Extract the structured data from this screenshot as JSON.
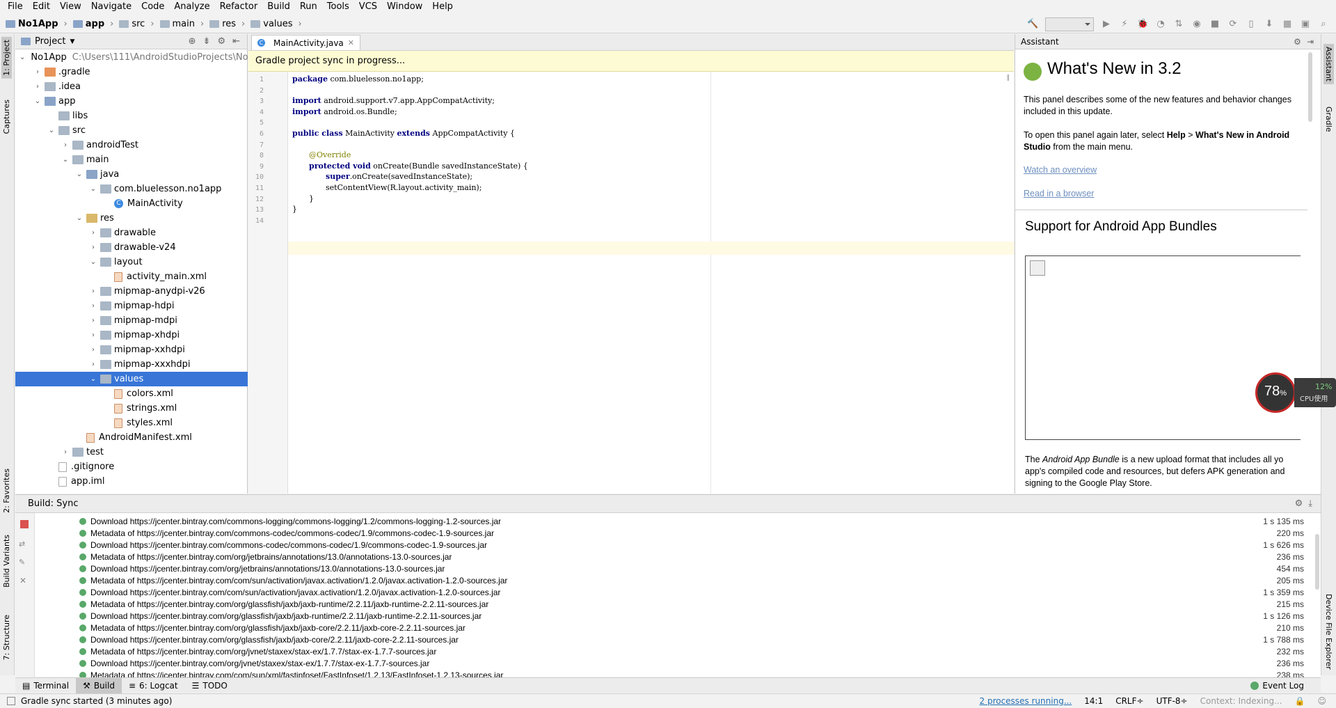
{
  "menu": [
    "File",
    "Edit",
    "View",
    "Navigate",
    "Code",
    "Analyze",
    "Refactor",
    "Build",
    "Run",
    "Tools",
    "VCS",
    "Window",
    "Help"
  ],
  "breadcrumb": [
    "No1App",
    "app",
    "src",
    "main",
    "res",
    "values"
  ],
  "left_tabs": {
    "project": "1: Project",
    "captures": "Captures",
    "favorites": "2: Favorites",
    "build_variants": "Build Variants",
    "structure": "7: Structure"
  },
  "right_tabs": {
    "assistant": "Assistant",
    "gradle": "Gradle",
    "device_file_explorer": "Device File Explorer"
  },
  "project_panel": {
    "title": "Project",
    "tree": [
      {
        "label": "No1App",
        "path": "C:\\Users\\111\\AndroidStudioProjects\\No",
        "icon": "folder-icon"
      },
      {
        "label": ".gradle",
        "icon": "folder-icon"
      },
      {
        "label": ".idea",
        "icon": "folder-icon"
      },
      {
        "label": "app",
        "icon": "folder-icon"
      },
      {
        "label": "libs",
        "icon": "folder-icon"
      },
      {
        "label": "src",
        "icon": "folder-icon"
      },
      {
        "label": "androidTest",
        "icon": "folder-icon"
      },
      {
        "label": "main",
        "icon": "folder-icon"
      },
      {
        "label": "java",
        "icon": "folder-icon"
      },
      {
        "label": "com.bluelesson.no1app",
        "icon": "package-icon"
      },
      {
        "label": "MainActivity",
        "icon": "class-icon"
      },
      {
        "label": "res",
        "icon": "folder-icon"
      },
      {
        "label": "drawable",
        "icon": "folder-icon"
      },
      {
        "label": "drawable-v24",
        "icon": "folder-icon"
      },
      {
        "label": "layout",
        "icon": "folder-icon"
      },
      {
        "label": "activity_main.xml",
        "icon": "xml-icon"
      },
      {
        "label": "mipmap-anydpi-v26",
        "icon": "folder-icon"
      },
      {
        "label": "mipmap-hdpi",
        "icon": "folder-icon"
      },
      {
        "label": "mipmap-mdpi",
        "icon": "folder-icon"
      },
      {
        "label": "mipmap-xhdpi",
        "icon": "folder-icon"
      },
      {
        "label": "mipmap-xxhdpi",
        "icon": "folder-icon"
      },
      {
        "label": "mipmap-xxxhdpi",
        "icon": "folder-icon"
      },
      {
        "label": "values",
        "icon": "folder-icon"
      },
      {
        "label": "colors.xml",
        "icon": "xml-icon"
      },
      {
        "label": "strings.xml",
        "icon": "xml-icon"
      },
      {
        "label": "styles.xml",
        "icon": "xml-icon"
      },
      {
        "label": "AndroidManifest.xml",
        "icon": "xml-icon"
      },
      {
        "label": "test",
        "icon": "folder-icon"
      },
      {
        "label": ".gitignore",
        "icon": "file-icon"
      },
      {
        "label": "app.iml",
        "icon": "file-icon"
      }
    ]
  },
  "editor": {
    "tab": "MainActivity.java",
    "banner": "Gradle project sync in progress...",
    "lines": [
      "1",
      "2",
      "3",
      "4",
      "5",
      "6",
      "7",
      "8",
      "9",
      "10",
      "11",
      "12",
      "13",
      "14"
    ],
    "code": {
      "l1_kw": "package",
      "l1": " com.bluelesson.no1app;",
      "l3_kw": "import",
      "l3": " android.support.v7.app.AppCompatActivity;",
      "l4_kw": "import",
      "l4": " android.os.Bundle;",
      "l6_kw1": "public class",
      "l6a": " MainActivity ",
      "l6_kw2": "extends",
      "l6b": " AppCompatActivity {",
      "l8": "@Override",
      "l9_kw": "protected void",
      "l9": " onCreate(Bundle savedInstanceState) {",
      "l10_kw": "super",
      "l10": ".onCreate(savedInstanceState);",
      "l11": "setContentView(R.layout.activity_main);",
      "l12": "}",
      "l13": "}"
    }
  },
  "assistant": {
    "header": "Assistant",
    "title": "What's New in 3.2",
    "p1": "This panel describes some of the new features and behavior changes included in this update.",
    "p2a": "To open this panel again later, select ",
    "p2b": "Help",
    "p2c": " > ",
    "p2d": "What's New in Android Studio",
    "p2e": " from the main menu.",
    "link1": "Watch an overview",
    "link2": "Read in a browser",
    "h2": "Support for Android App Bundles",
    "p3a": "The ",
    "p3b": "Android App Bundle",
    "p3c": " is a new upload format that includes all yo app's compiled code and resources, but defers APK generation and signing to the Google Play Store."
  },
  "cpu_widget": {
    "value": "78",
    "unit": "%",
    "cpu_pct": "12%",
    "cpu_label": "CPU使用"
  },
  "build_panel": {
    "title": "Build: Sync",
    "rows": [
      {
        "text": "Download https://jcenter.bintray.com/commons-logging/commons-logging/1.2/commons-logging-1.2-sources.jar",
        "time": "1 s 135 ms"
      },
      {
        "text": "Metadata of https://jcenter.bintray.com/commons-codec/commons-codec/1.9/commons-codec-1.9-sources.jar",
        "time": "220 ms"
      },
      {
        "text": "Download https://jcenter.bintray.com/commons-codec/commons-codec/1.9/commons-codec-1.9-sources.jar",
        "time": "1 s 626 ms"
      },
      {
        "text": "Metadata of https://jcenter.bintray.com/org/jetbrains/annotations/13.0/annotations-13.0-sources.jar",
        "time": "236 ms"
      },
      {
        "text": "Download https://jcenter.bintray.com/org/jetbrains/annotations/13.0/annotations-13.0-sources.jar",
        "time": "454 ms"
      },
      {
        "text": "Metadata of https://jcenter.bintray.com/com/sun/activation/javax.activation/1.2.0/javax.activation-1.2.0-sources.jar",
        "time": "205 ms"
      },
      {
        "text": "Download https://jcenter.bintray.com/com/sun/activation/javax.activation/1.2.0/javax.activation-1.2.0-sources.jar",
        "time": "1 s 359 ms"
      },
      {
        "text": "Metadata of https://jcenter.bintray.com/org/glassfish/jaxb/jaxb-runtime/2.2.11/jaxb-runtime-2.2.11-sources.jar",
        "time": "215 ms"
      },
      {
        "text": "Download https://jcenter.bintray.com/org/glassfish/jaxb/jaxb-runtime/2.2.11/jaxb-runtime-2.2.11-sources.jar",
        "time": "1 s 126 ms"
      },
      {
        "text": "Metadata of https://jcenter.bintray.com/org/glassfish/jaxb/jaxb-core/2.2.11/jaxb-core-2.2.11-sources.jar",
        "time": "210 ms"
      },
      {
        "text": "Download https://jcenter.bintray.com/org/glassfish/jaxb/jaxb-core/2.2.11/jaxb-core-2.2.11-sources.jar",
        "time": "1 s 788 ms"
      },
      {
        "text": "Metadata of https://jcenter.bintray.com/org/jvnet/staxex/stax-ex/1.7.7/stax-ex-1.7.7-sources.jar",
        "time": "232 ms"
      },
      {
        "text": "Download https://jcenter.bintray.com/org/jvnet/staxex/stax-ex/1.7.7/stax-ex-1.7.7-sources.jar",
        "time": "236 ms"
      },
      {
        "text": "Metadata of https://jcenter.bintray.com/com/sun/xml/fastinfoset/FastInfoset/1.2.13/FastInfoset-1.2.13-sources.jar",
        "time": "238 ms"
      }
    ]
  },
  "bottom_tabs": {
    "terminal": "Terminal",
    "build": "Build",
    "logcat": "6: Logcat",
    "todo": "TODO",
    "event_log": "Event Log"
  },
  "status": {
    "message": "Gradle sync started (3 minutes ago)",
    "processes": "2 processes running...",
    "position": "14:1",
    "line_sep": "CRLF÷",
    "encoding": "UTF-8÷",
    "context": "Context: Indexing..."
  },
  "colors": {
    "selection": "#3875d7",
    "banner": "#fdfbd4",
    "keyword": "#000080",
    "link": "#6d8fbf",
    "ok": "#59a869"
  }
}
